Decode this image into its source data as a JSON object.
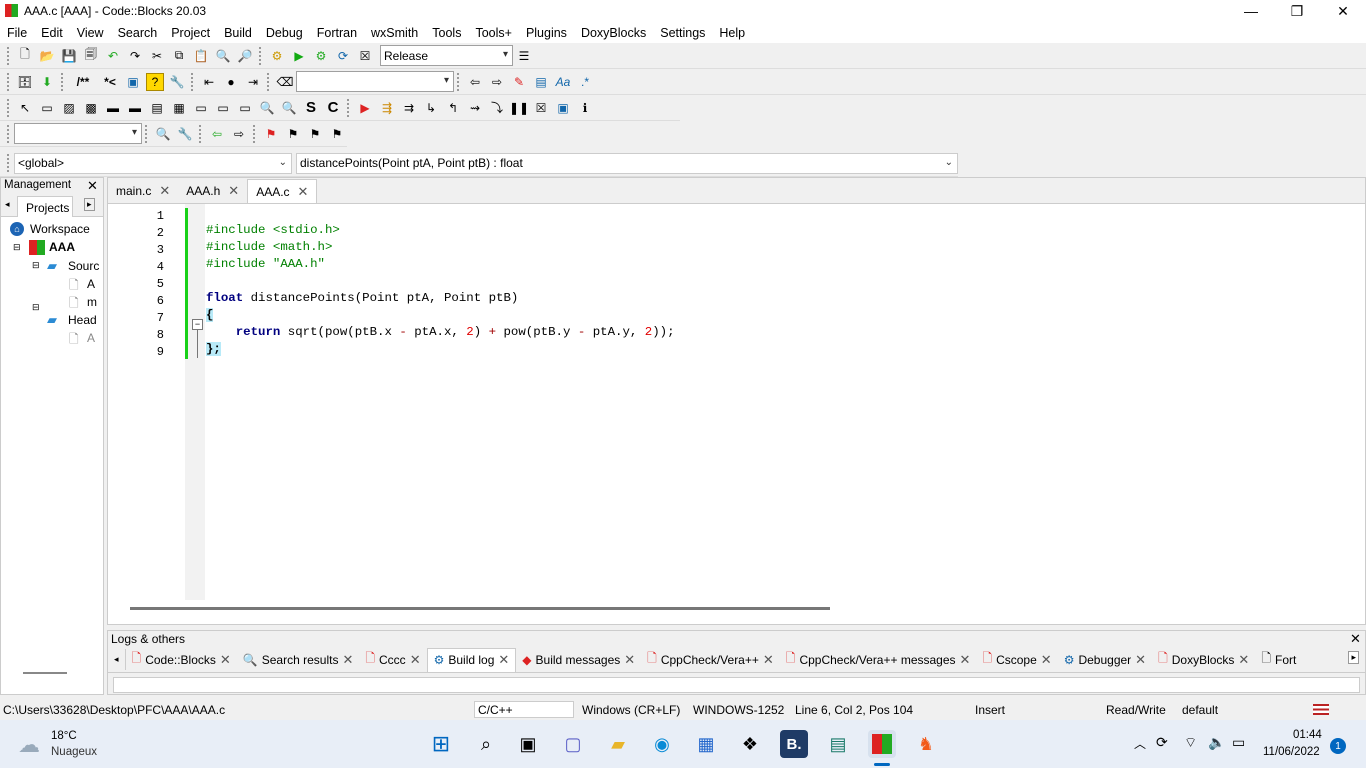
{
  "window": {
    "title": "AAA.c [AAA] - Code::Blocks 20.03",
    "minimize": "—",
    "restore": "❐",
    "close": "✕"
  },
  "menu": [
    "File",
    "Edit",
    "View",
    "Search",
    "Project",
    "Build",
    "Debug",
    "Fortran",
    "wxSmith",
    "Tools",
    "Tools+",
    "Plugins",
    "DoxyBlocks",
    "Settings",
    "Help"
  ],
  "toolbar": {
    "build_target": "Release"
  },
  "scope": {
    "global": "<global>",
    "function": "distancePoints(Point ptA, Point ptB) : float"
  },
  "management": {
    "title": "Management",
    "tab": "Projects",
    "workspace": "Workspace",
    "project": "AAA",
    "sources_folder": "Sourc",
    "source_file1": "A",
    "source_file2": "m",
    "headers_folder": "Head",
    "header_file1": "A"
  },
  "editor_tabs": [
    {
      "label": "main.c"
    },
    {
      "label": "AAA.h"
    },
    {
      "label": "AAA.c"
    }
  ],
  "code": {
    "line_numbers": [
      "1",
      "2",
      "3",
      "4",
      "5",
      "6",
      "7",
      "8",
      "9"
    ],
    "l1": "#include <stdio.h>",
    "l2": "#include <math.h>",
    "l3": "#include \"AAA.h\"",
    "l5_kw": "float",
    "l5_name": " distancePoints",
    "l5_rest": "(Point ptA, Point ptB)",
    "l6": "{",
    "l7_kw": "return",
    "l7_a": " sqrt(pow(ptB.x ",
    "l7_m1": "-",
    "l7_b": " ptA.x, ",
    "l7_n1": "2",
    "l7_c": ") ",
    "l7_p": "+",
    "l7_d": " pow(ptB.y ",
    "l7_m2": "-",
    "l7_e": " ptA.y, ",
    "l7_n2": "2",
    "l7_f": "));",
    "l8": "};"
  },
  "logs": {
    "title": "Logs & others",
    "tabs": [
      "Code::Blocks",
      "Search results",
      "Cccc",
      "Build log",
      "Build messages",
      "CppCheck/Vera++",
      "CppCheck/Vera++ messages",
      "Cscope",
      "Debugger",
      "DoxyBlocks",
      "Fort"
    ]
  },
  "status": {
    "path": "C:\\Users\\33628\\Desktop\\PFC\\AAA\\AAA.c",
    "lang": "C/C++",
    "eol": "Windows (CR+LF)",
    "encoding": "WINDOWS-1252",
    "position": "Line 6, Col 2, Pos 104",
    "mode": "Insert",
    "access": "Read/Write",
    "profile": "default"
  },
  "taskbar": {
    "temp": "18°C",
    "weather": "Nuageux",
    "time": "01:44",
    "date": "11/06/2022",
    "notif": "1"
  }
}
